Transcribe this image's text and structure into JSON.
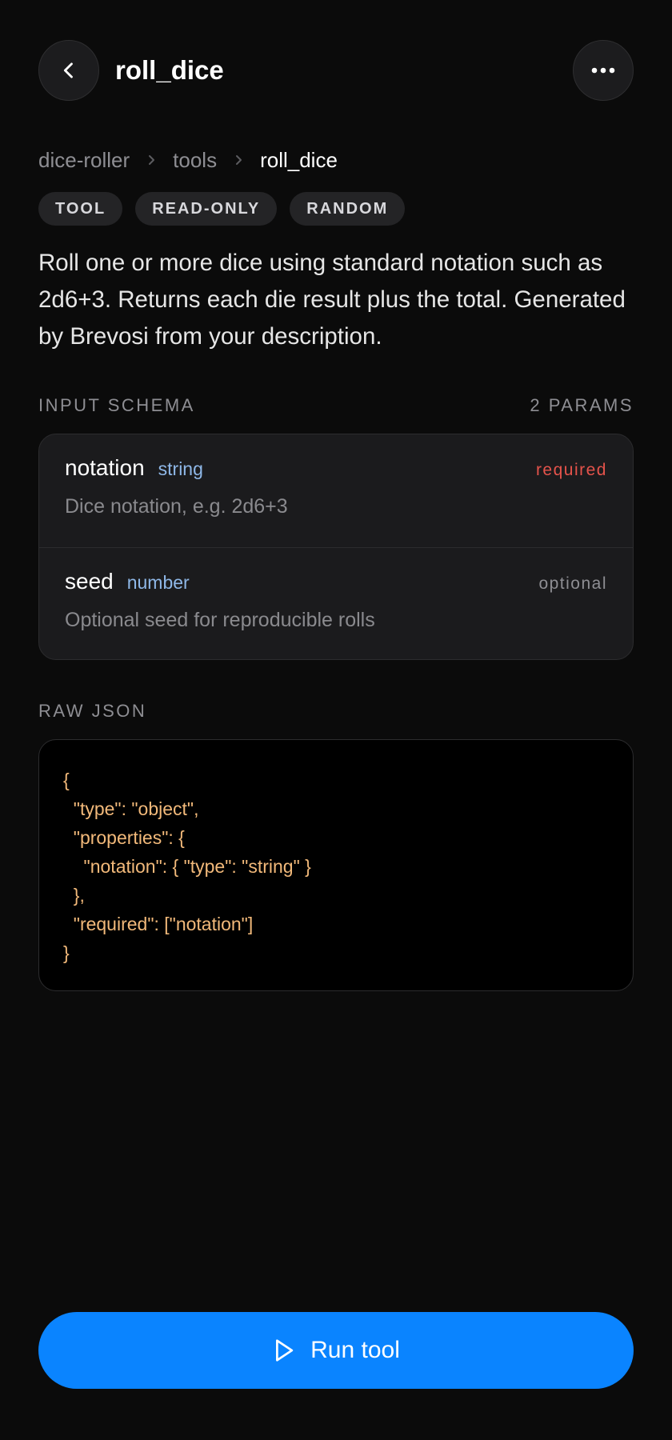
{
  "header": {
    "title": "roll_dice",
    "back_icon": "chevron-left-icon",
    "more_icon": "more-horizontal-icon"
  },
  "breadcrumb": {
    "items": [
      "dice-roller",
      "tools",
      "roll_dice"
    ],
    "separator_icon": "chevron-right-icon"
  },
  "tags": [
    "TOOL",
    "READ-ONLY",
    "RANDOM"
  ],
  "description": "Roll one or more dice using standard notation such as 2d6+3. Returns each die result plus the total. Generated by Brevosi from your description.",
  "input_schema": {
    "label": "INPUT SCHEMA",
    "count": "2 PARAMS",
    "params": [
      {
        "name": "notation",
        "type": "string",
        "flag": "required",
        "description": "Dice notation, e.g. 2d6+3"
      },
      {
        "name": "seed",
        "type": "number",
        "flag": "optional",
        "description": "Optional seed for reproducible rolls"
      }
    ]
  },
  "raw_json": {
    "label": "RAW JSON",
    "lines": [
      "{",
      "  \"type\": \"object\",",
      "  \"properties\": {",
      "    \"notation\": { \"type\": \"string\" }",
      "  },",
      "  \"required\": [\"notation\"]",
      "}"
    ]
  },
  "run_button": {
    "label": "Run tool",
    "icon": "play-icon"
  },
  "colors": {
    "background": "#0b0b0b",
    "accent": "#0a84ff",
    "required": "#e5534b",
    "type": "#8fb8e8",
    "code": "#f2b97a"
  }
}
